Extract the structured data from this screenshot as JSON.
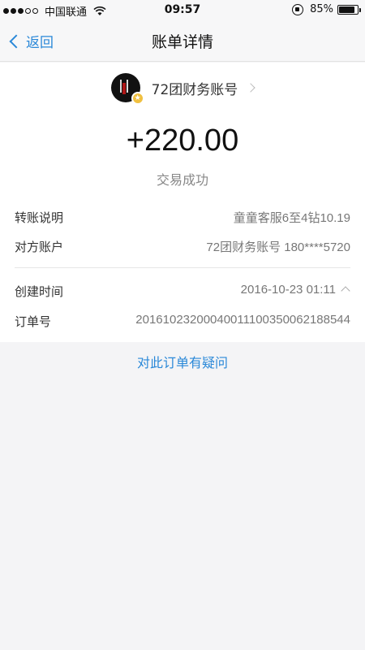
{
  "status_bar": {
    "carrier": "中国联通",
    "time": "09:57",
    "battery": "85%",
    "battery_level": 0.85,
    "signal_dots": 3,
    "signal_total": 5
  },
  "nav": {
    "back_label": "返回",
    "title": "账单详情"
  },
  "payee": {
    "name": "72团财务账号"
  },
  "transaction": {
    "amount": "+220.00",
    "status": "交易成功"
  },
  "details": {
    "note_label": "转账说明",
    "note_value": "童童客服6至4钻10.19",
    "account_label": "对方账户",
    "account_value": "72团财务账号 180****5720",
    "created_label": "创建时间",
    "created_value": "2016-10-23 01:11",
    "order_label": "订单号",
    "order_value": "20161023200040011100350062188544"
  },
  "question_link": "对此订单有疑问",
  "colors": {
    "accent": "#2a88d8",
    "background": "#f4f4f6",
    "card": "#ffffff"
  }
}
